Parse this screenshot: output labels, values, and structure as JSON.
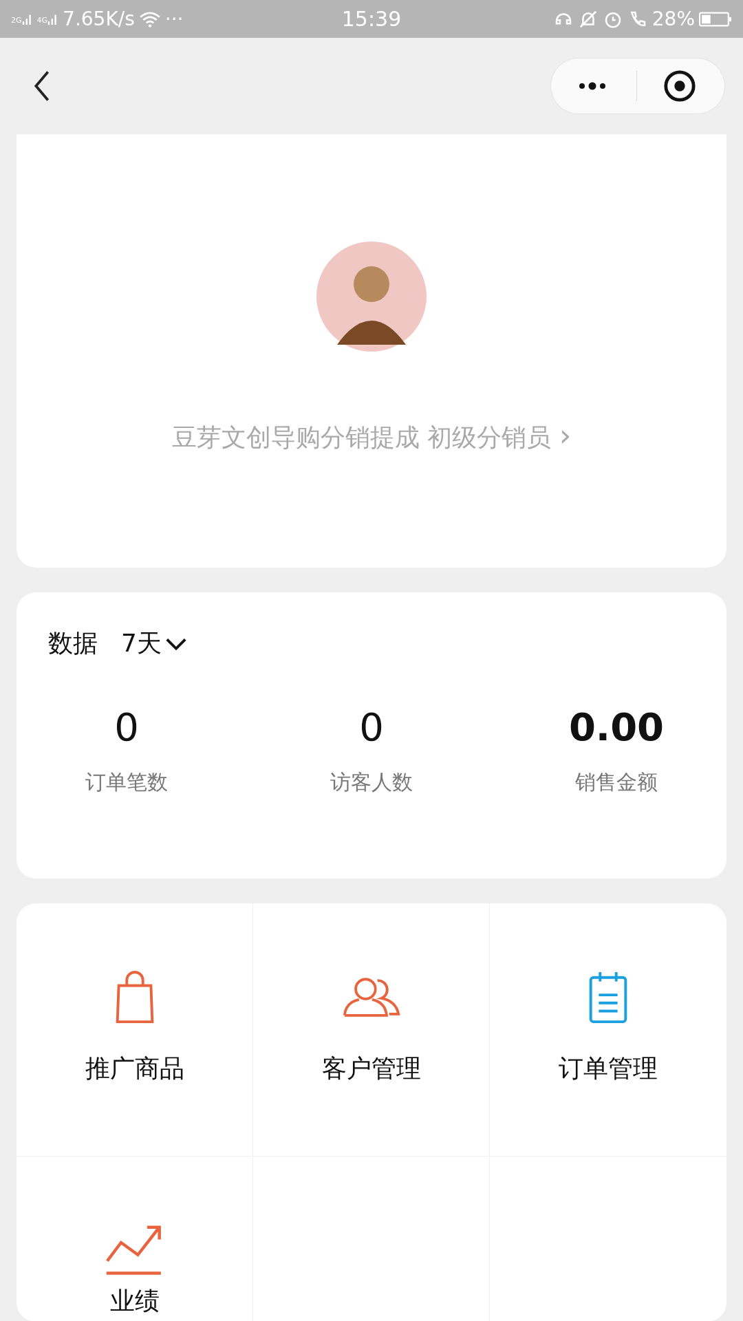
{
  "status_bar": {
    "signal_1": "2G",
    "signal_2": "4G",
    "speed": "7.65K/s",
    "dots": "···",
    "time": "15:39",
    "battery": "28%"
  },
  "profile": {
    "subtitle": "豆芽文创导购分销提成 初级分销员",
    "arrow": "›"
  },
  "data": {
    "title": "数据",
    "period": "7天",
    "stats": [
      {
        "value": "0",
        "label": "订单笔数",
        "kind": "count"
      },
      {
        "value": "0",
        "label": "访客人数",
        "kind": "count"
      },
      {
        "value": "0.00",
        "label": "销售金额",
        "kind": "amount"
      }
    ]
  },
  "menu": [
    {
      "label": "推广商品",
      "kind": "bag",
      "color": "#e8643f"
    },
    {
      "label": "客户管理",
      "kind": "people",
      "color": "#e8643f"
    },
    {
      "label": "订单管理",
      "kind": "clipboard",
      "color": "#1aa0e0"
    },
    {
      "label": "业绩",
      "kind": "trend",
      "color": "#e8643f"
    }
  ]
}
